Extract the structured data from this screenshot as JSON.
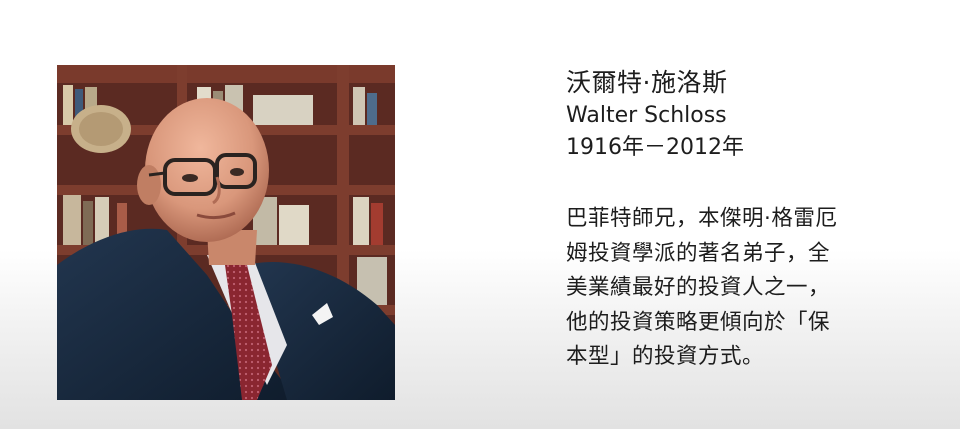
{
  "portrait": {
    "alt": "Walter Schloss"
  },
  "person": {
    "name_zh": "沃爾特·施洛斯",
    "name_en": "Walter Schloss",
    "years": "1916年－2012年"
  },
  "bio": {
    "lines": [
      "巴菲特師兄，本傑明·格雷厄",
      "姆投資學派的著名弟子，全",
      "美業績最好的投資人之一，",
      "他的投資策略更傾向於「保",
      "本型」的投資方式。"
    ]
  }
}
